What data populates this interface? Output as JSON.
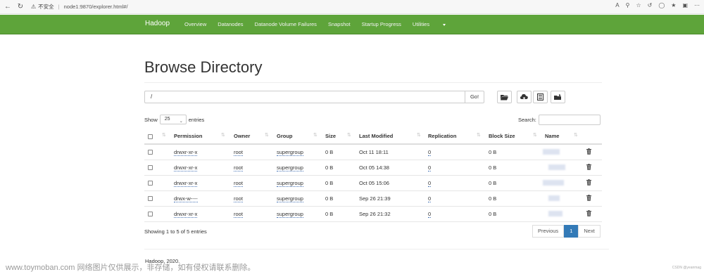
{
  "browser": {
    "security": "不安全",
    "url": "node1:9870/explorer.html#/"
  },
  "navbar": {
    "brand": "Hadoop",
    "items": [
      "Overview",
      "Datanodes",
      "Datanode Volume Failures",
      "Snapshot",
      "Startup Progress",
      "Utilities"
    ]
  },
  "page": {
    "title": "Browse Directory",
    "path_value": "/",
    "go_label": "Go!",
    "show_label": "Show",
    "entries_value": "25",
    "entries_label": "entries",
    "search_label": "Search:"
  },
  "table": {
    "headers": [
      "Permission",
      "Owner",
      "Group",
      "Size",
      "Last Modified",
      "Replication",
      "Block Size",
      "Name"
    ],
    "rows": [
      {
        "permission": "drwxr-xr-x",
        "owner": "root",
        "group": "supergroup",
        "size": "0 B",
        "modified": "Oct 11 18:11",
        "replication": "0",
        "block_size": "0 B"
      },
      {
        "permission": "drwxr-xr-x",
        "owner": "root",
        "group": "supergroup",
        "size": "0 B",
        "modified": "Oct 05 14:38",
        "replication": "0",
        "block_size": "0 B"
      },
      {
        "permission": "drwxr-xr-x",
        "owner": "root",
        "group": "supergroup",
        "size": "0 B",
        "modified": "Oct 05 15:06",
        "replication": "0",
        "block_size": "0 B"
      },
      {
        "permission": "drwx-w----",
        "owner": "root",
        "group": "supergroup",
        "size": "0 B",
        "modified": "Sep 26 21:39",
        "replication": "0",
        "block_size": "0 B"
      },
      {
        "permission": "drwxr-xr-x",
        "owner": "root",
        "group": "supergroup",
        "size": "0 B",
        "modified": "Sep 26 21:32",
        "replication": "0",
        "block_size": "0 B"
      }
    ]
  },
  "pagination": {
    "summary": "Showing 1 to 5 of 5 entries",
    "previous": "Previous",
    "current": "1",
    "next": "Next"
  },
  "footer": {
    "text": "Hadoop, 2020."
  },
  "watermark": {
    "text": "www.toymoban.com 网络图片仅供展示，非存储，如有侵权请联系删除。",
    "credit": "CSDN @yeanmag"
  },
  "colors": {
    "navbar": "#5ea43a",
    "primary": "#337ab7"
  }
}
